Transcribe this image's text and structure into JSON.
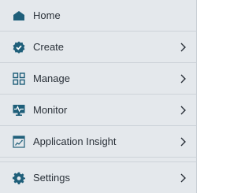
{
  "colors": {
    "icon": "#1f5f7a",
    "text": "#2a3139",
    "background": "#e4e8ec"
  },
  "menu": {
    "items": [
      {
        "label": "Home",
        "icon": "home-icon",
        "has_submenu": false
      },
      {
        "label": "Create",
        "icon": "badge-check-icon",
        "has_submenu": true
      },
      {
        "label": "Manage",
        "icon": "grid-icon",
        "has_submenu": true
      },
      {
        "label": "Monitor",
        "icon": "monitor-pulse-icon",
        "has_submenu": true
      },
      {
        "label": "Application Insight",
        "icon": "insight-chart-icon",
        "has_submenu": true
      },
      {
        "label": "Settings",
        "icon": "gear-icon",
        "has_submenu": true
      }
    ]
  }
}
